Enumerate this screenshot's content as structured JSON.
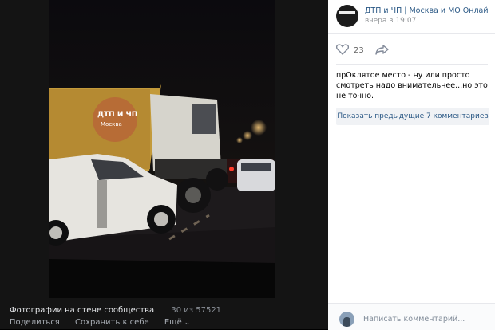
{
  "viewer": {
    "album_title": "Фотографии на стене сообщества",
    "counter": "30 из 57521",
    "actions": [
      "Поделиться",
      "Сохранить к себе",
      "Ещё"
    ],
    "watermark_line1": "ДТП И ЧП",
    "watermark_line2": "Москва"
  },
  "post": {
    "group_name": "ДТП и ЧП | Москва и МО Онлайн | ...",
    "time": "вчера в 19:07",
    "likes": "23",
    "comment_text": "прОклятое место - ну или просто смотреть надо внимательнее...но это не точно.",
    "show_prev_comments": "Показать предыдущие 7 комментариев",
    "composer_placeholder": "Написать комментарий..."
  },
  "icons": [
    "heart-icon",
    "share-icon",
    "chevron-down-icon"
  ]
}
